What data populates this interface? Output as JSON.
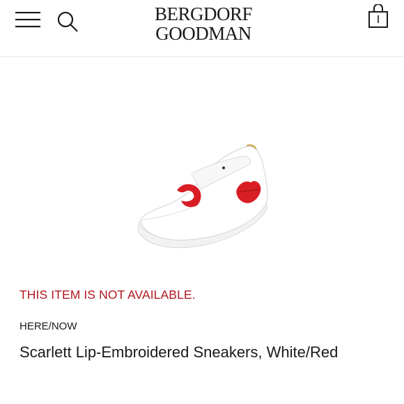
{
  "header": {
    "logo_line1": "BERGDORF",
    "logo_line2": "GOODMAN",
    "menu_icon": "hamburger-menu-icon",
    "search_icon": "search-icon",
    "bag_icon": "shopping-bag-icon"
  },
  "product": {
    "availability_text": "THIS ITEM IS NOT AVAILABLE.",
    "brand": "HERE/NOW",
    "name": "Scarlett Lip-Embroidered Sneakers, White/Red",
    "image_alt": "sneaker-image"
  },
  "colors": {
    "availability": "#b01a22",
    "text": "#1a1a1a",
    "divider": "#e6e6e6"
  }
}
